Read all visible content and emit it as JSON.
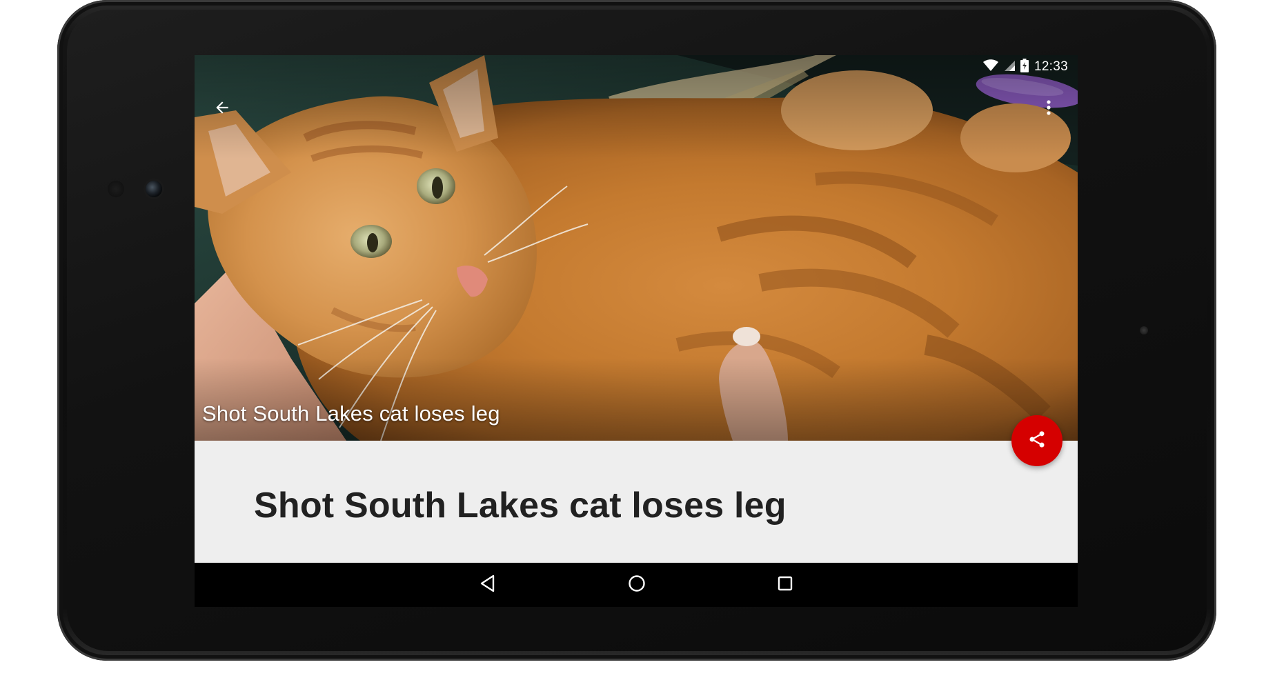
{
  "status_bar": {
    "time": "12:33",
    "icons": [
      "wifi-icon",
      "signal-icon",
      "battery-charging-icon"
    ]
  },
  "toolbar": {
    "back_icon": "arrow-back-icon",
    "menu_icon": "more-vert-icon"
  },
  "hero": {
    "image_subject": "orange tabby cat being held",
    "caption": "Shot South Lakes cat loses leg"
  },
  "article": {
    "title": "Shot South Lakes cat loses leg"
  },
  "fab": {
    "icon": "share-icon",
    "color": "#d50000"
  },
  "navigation_bar": {
    "buttons": [
      "nav-back-icon",
      "nav-home-icon",
      "nav-recents-icon"
    ]
  },
  "colors": {
    "accent": "#d50000",
    "article_background": "#eeeeee",
    "title_text": "#212121"
  }
}
